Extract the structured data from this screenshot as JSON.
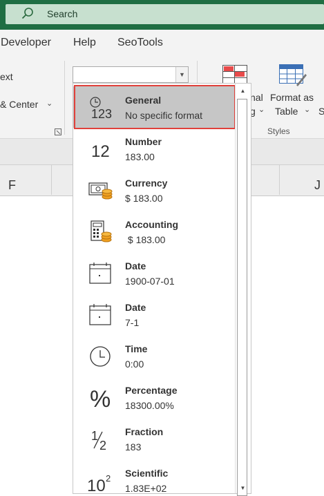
{
  "search": {
    "label": "Search"
  },
  "menu": {
    "items": [
      "Developer",
      "Help",
      "SeoTools"
    ]
  },
  "ribbon": {
    "wrap_text_partial": "ext",
    "merge_center_partial": "& Center",
    "conditional_line1_partial": "nal",
    "conditional_line2_partial": "g",
    "format_table_line1": "Format as",
    "format_table_line2": "Table",
    "cell_styles_partial": "S",
    "styles_group_label": "Styles",
    "number_format_value": ""
  },
  "columns": {
    "left": "F",
    "right": "J"
  },
  "formats": [
    {
      "name": "General",
      "example": "No specific format",
      "icon": "general-clock-123-icon",
      "selected": true
    },
    {
      "name": "Number",
      "example": "183.00",
      "icon": "number-12-icon"
    },
    {
      "name": "Currency",
      "example": "$ 183.00",
      "icon": "currency-icon"
    },
    {
      "name": "Accounting",
      "example": " $ 183.00",
      "icon": "accounting-calculator-icon"
    },
    {
      "name": "Date",
      "example": "1900-07-01",
      "icon": "calendar-icon"
    },
    {
      "name": "Date",
      "example": "7-1",
      "icon": "calendar-icon"
    },
    {
      "name": "Time",
      "example": "0:00",
      "icon": "clock-icon"
    },
    {
      "name": "Percentage",
      "example": "18300.00%",
      "icon": "percent-icon"
    },
    {
      "name": "Fraction",
      "example": "183",
      "icon": "fraction-icon"
    },
    {
      "name": "Scientific",
      "example": "1.83E+02",
      "icon": "scientific-icon"
    }
  ],
  "colors": {
    "accent": "#1f6e43",
    "selection_border": "#e0403a",
    "coin": "#f0a020"
  }
}
